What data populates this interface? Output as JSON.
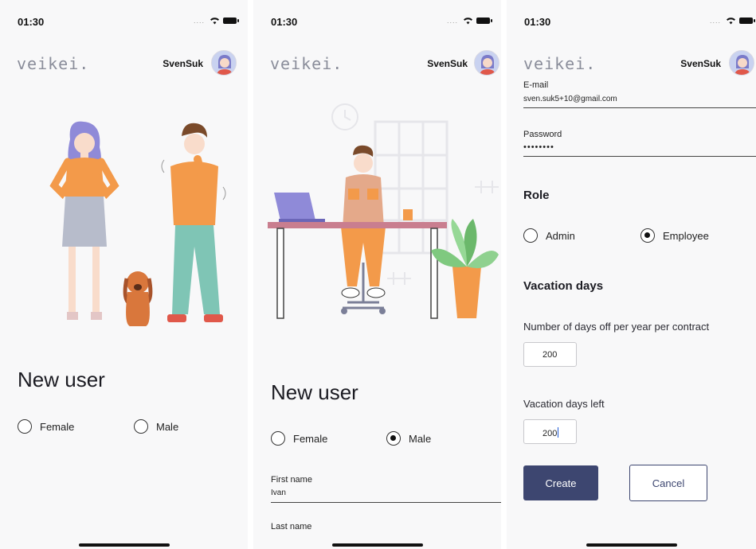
{
  "status_bar": {
    "time": "01:30"
  },
  "header": {
    "logo": "veikei.",
    "user_name": "SvenSuk"
  },
  "screen1": {
    "heading": "New user",
    "gender_options": [
      {
        "label": "Female",
        "selected": false
      },
      {
        "label": "Male",
        "selected": false
      }
    ]
  },
  "screen2": {
    "heading": "New user",
    "gender_options": [
      {
        "label": "Female",
        "selected": false
      },
      {
        "label": "Male",
        "selected": true
      }
    ],
    "first_name": {
      "label": "First name",
      "value": "Ivan"
    },
    "last_name": {
      "label": "Last name",
      "value": ""
    }
  },
  "screen3": {
    "email": {
      "label": "E-mail",
      "value": "sven.suk5+10@gmail.com"
    },
    "password": {
      "label": "Password",
      "value": "••••••••"
    },
    "role": {
      "title": "Role",
      "options": [
        {
          "label": "Admin",
          "selected": false
        },
        {
          "label": "Employee",
          "selected": true
        }
      ]
    },
    "vacation": {
      "title": "Vacation days",
      "days_per_year_label": "Number of days off per year per contract",
      "days_per_year_value": "200",
      "days_left_label": "Vacation days left",
      "days_left_value": "200"
    },
    "create_label": "Create",
    "cancel_label": "Cancel"
  },
  "colors": {
    "primary": "#3d4670",
    "background": "#f8f8f9",
    "accent_orange": "#f39a4a",
    "accent_purple": "#8f8ad8"
  },
  "icons": [
    "wifi-icon",
    "battery-icon",
    "avatar",
    "radio-icon"
  ]
}
